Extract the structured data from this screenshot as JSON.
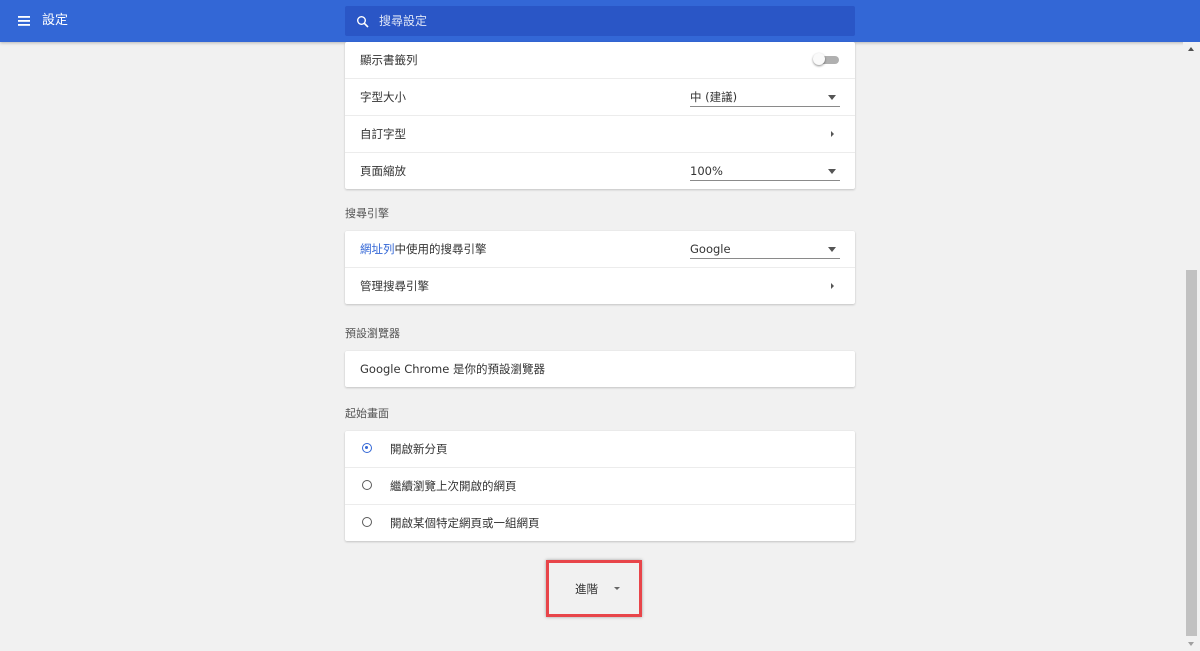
{
  "header": {
    "title": "設定",
    "search_placeholder": "搜尋設定",
    "accent_color": "#3367d6"
  },
  "appearance": {
    "rows": [
      {
        "label": "顯示書籤列",
        "control": "toggle",
        "checked": false
      },
      {
        "label": "字型大小",
        "control": "select",
        "value": "中 (建議)"
      },
      {
        "label": "自訂字型",
        "control": "arrow"
      },
      {
        "label": "頁面縮放",
        "control": "select",
        "value": "100%"
      }
    ]
  },
  "search_engine": {
    "title": "搜尋引擎",
    "address_bar_link": "網址列",
    "address_bar_text": "中使用的搜尋引擎",
    "engine_value": "Google",
    "manage_label": "管理搜尋引擎"
  },
  "default_browser": {
    "title": "預設瀏覽器",
    "status": "Google Chrome 是你的預設瀏覽器"
  },
  "startup": {
    "title": "起始畫面",
    "options": [
      {
        "label": "開啟新分頁",
        "checked": true
      },
      {
        "label": "繼續瀏覽上次開啟的網頁",
        "checked": false
      },
      {
        "label": "開啟某個特定網頁或一組網頁",
        "checked": false
      }
    ]
  },
  "advanced": {
    "label": "進階",
    "highlight_color": "#e8454a"
  }
}
